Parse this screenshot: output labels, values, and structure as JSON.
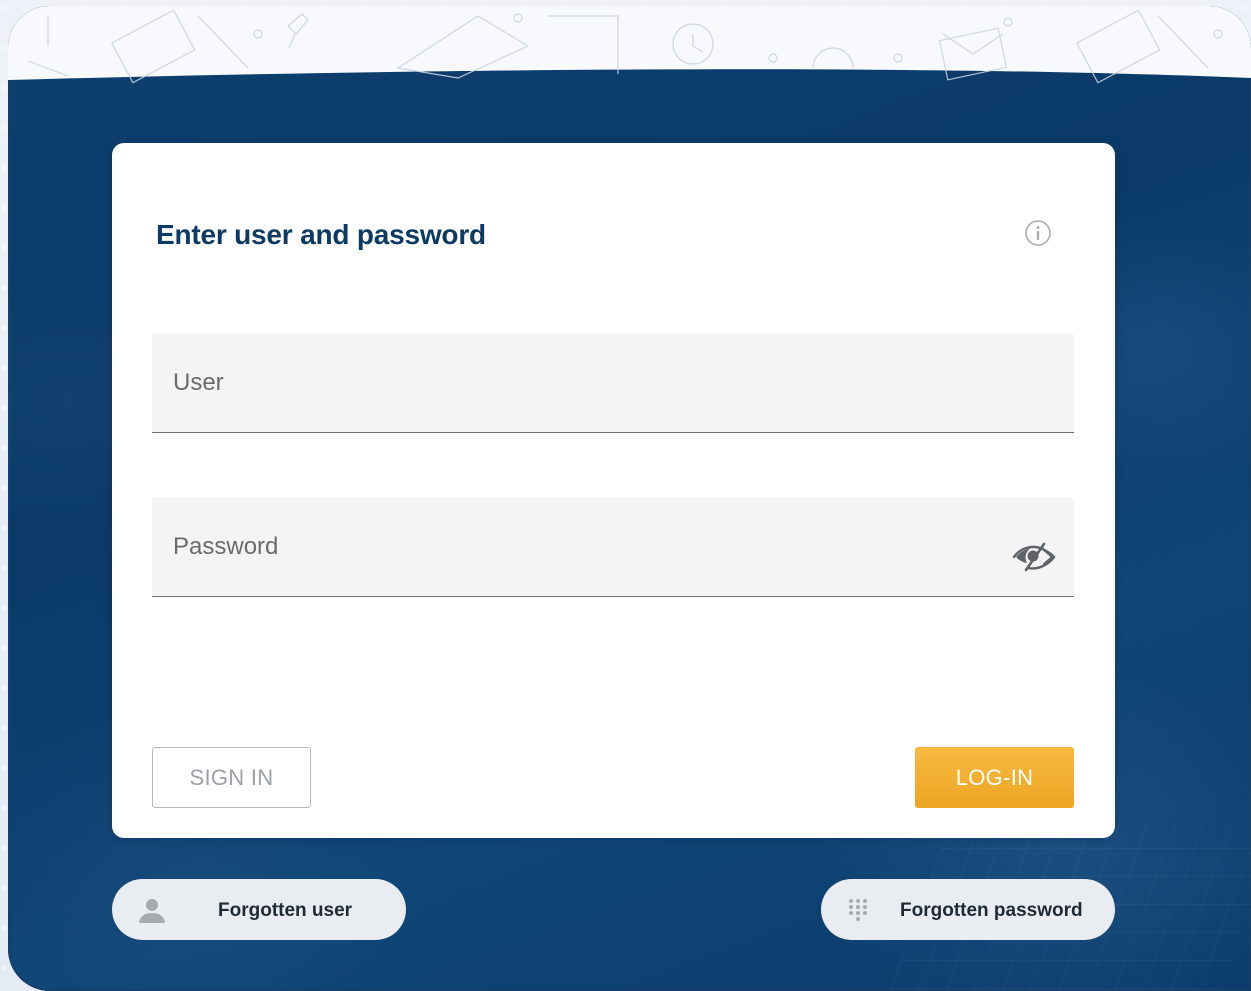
{
  "login": {
    "title": "Enter user and password",
    "user_label": "User",
    "user_value": "",
    "password_label": "Password",
    "password_value": "",
    "signin_label": "SIGN IN",
    "login_label": "LOG-IN"
  },
  "links": {
    "forgotten_user": "Forgotten user",
    "forgotten_password": "Forgotten password"
  },
  "icons": {
    "info": "info-icon",
    "eye": "eye-slash-icon",
    "user": "user-icon",
    "keypad": "keypad-icon"
  },
  "colors": {
    "background": "#0d3f6f",
    "title": "#0d3a63",
    "accent": "#f0a92a",
    "field_bg": "#f4f4f4"
  }
}
